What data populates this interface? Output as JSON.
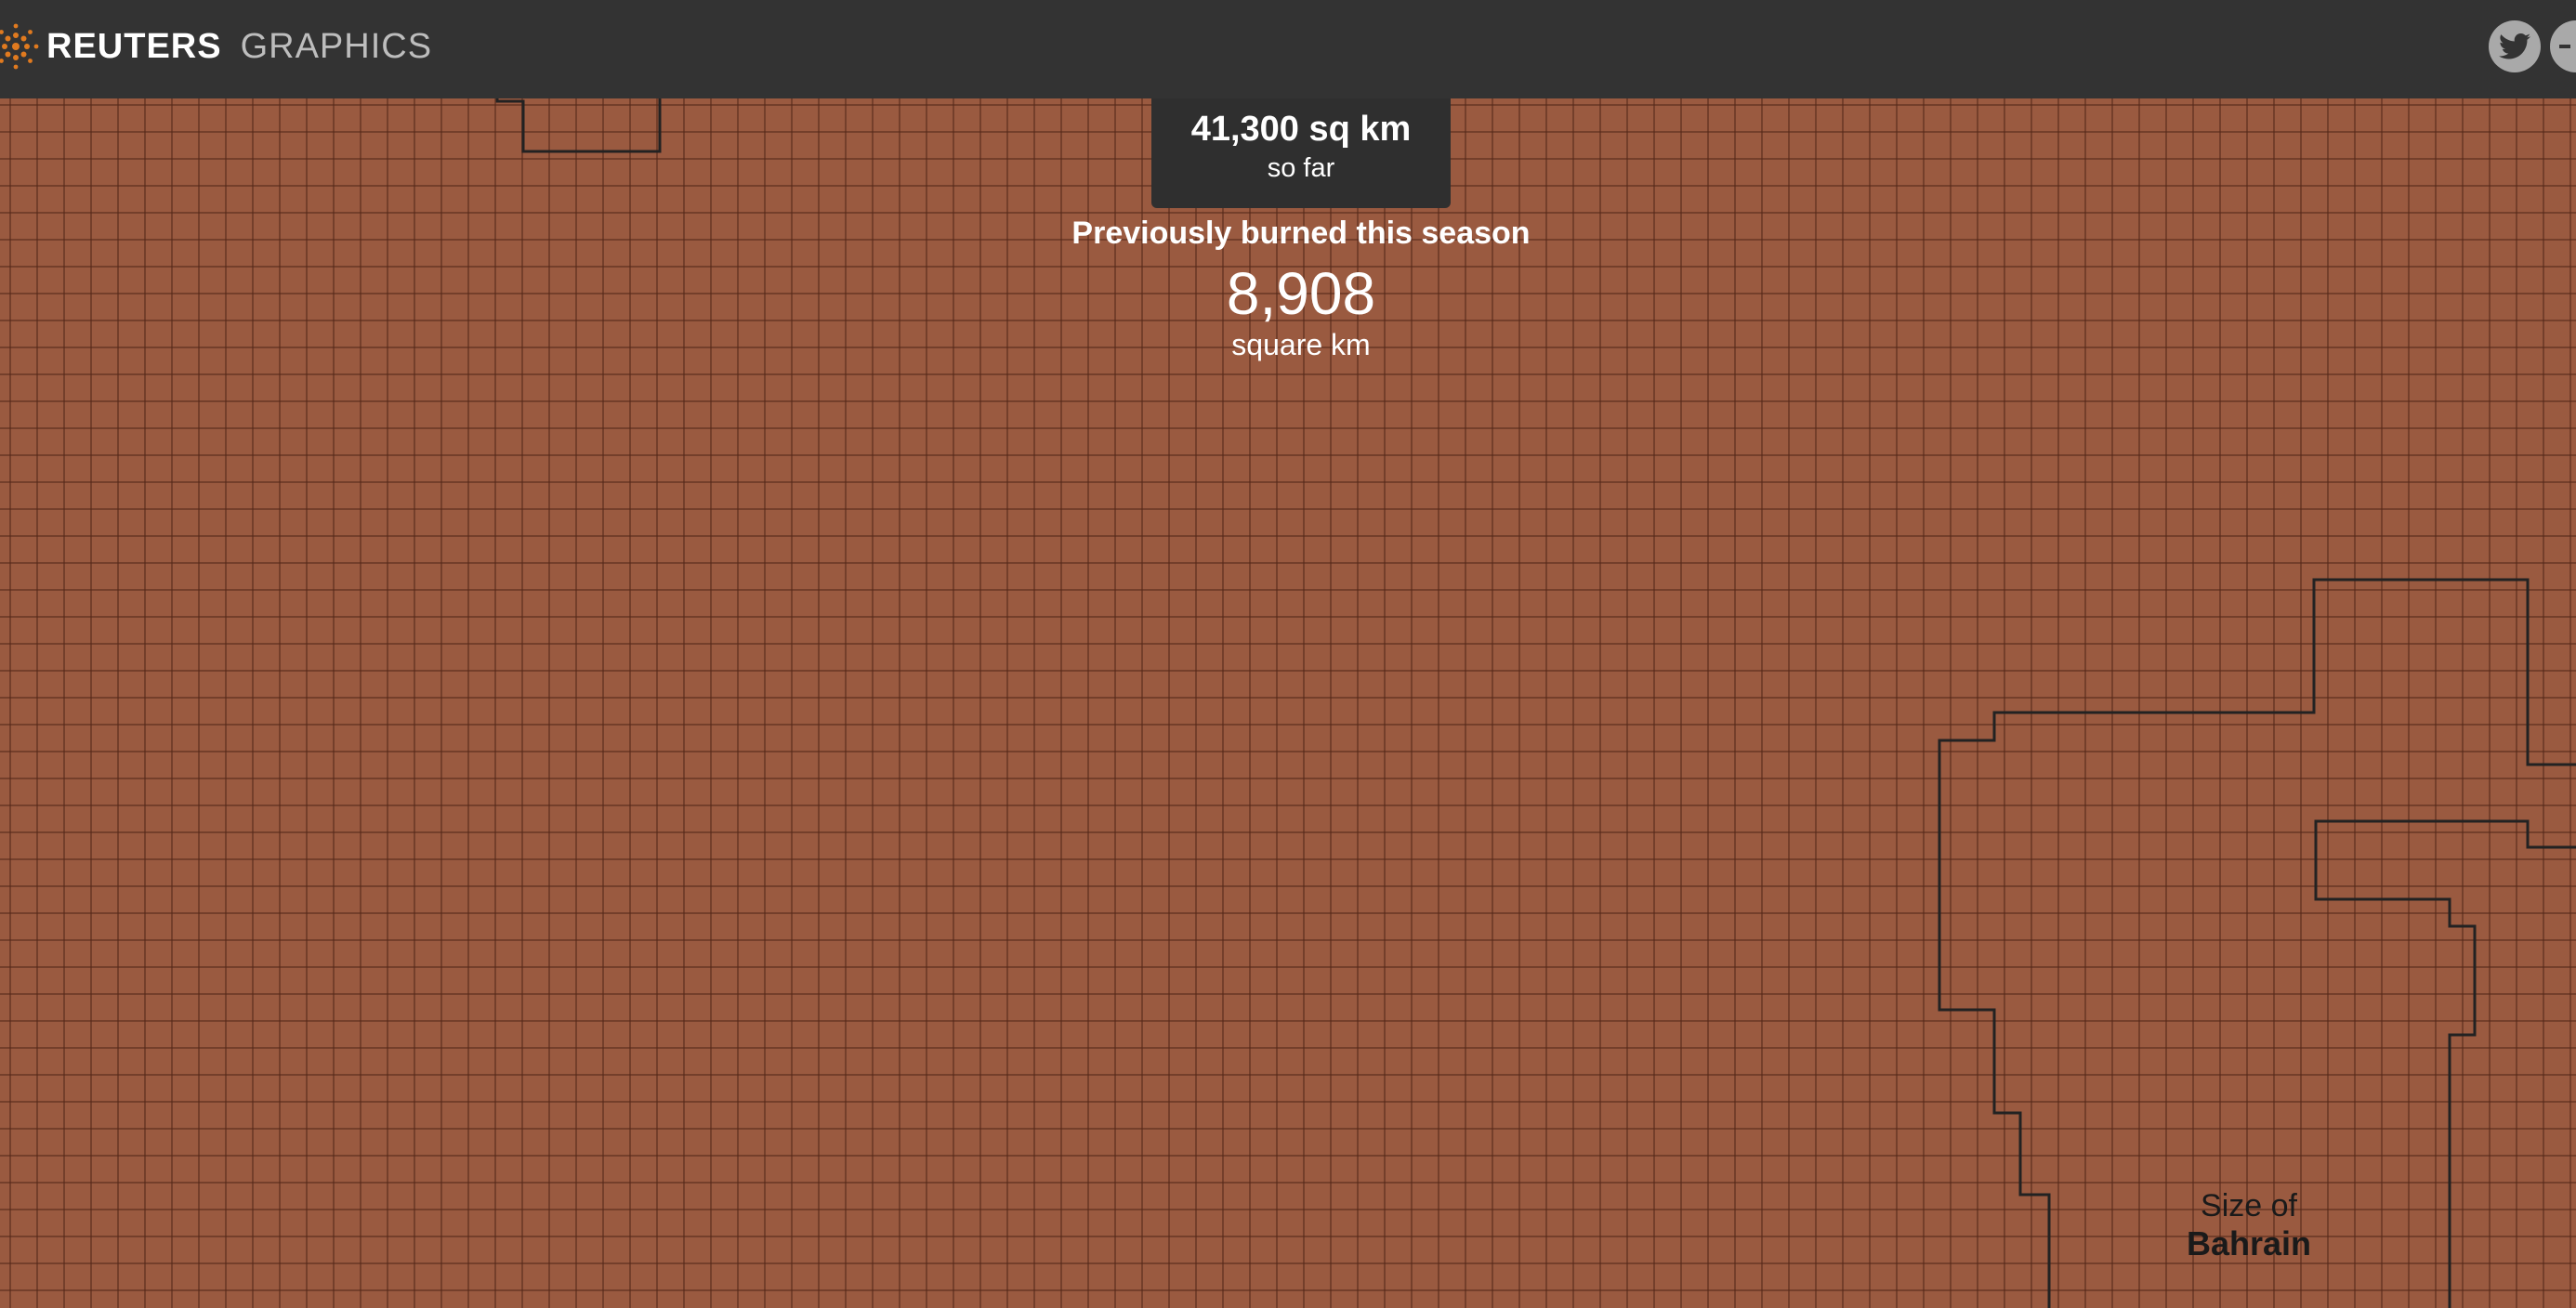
{
  "header": {
    "brand_name": "REUTERS",
    "section_name": "GRAPHICS",
    "logo_icon": "reuters-logo-icon",
    "share": [
      {
        "icon": "twitter-icon"
      },
      {
        "icon": "share-icon"
      }
    ]
  },
  "tooltip": {
    "value": "41,300 sq km",
    "sub": "so far"
  },
  "previous": {
    "heading": "Previously burned this season",
    "value": "8,908",
    "unit": "square km"
  },
  "size_label": {
    "prefix": "Size of",
    "name": "Bahrain"
  },
  "colors": {
    "grid_fill": "#9a5a40",
    "navbar": "#333333",
    "tooltip_bg": "#2f2f2f",
    "outline": "#222222",
    "logo_accent": "#e07a1f"
  }
}
